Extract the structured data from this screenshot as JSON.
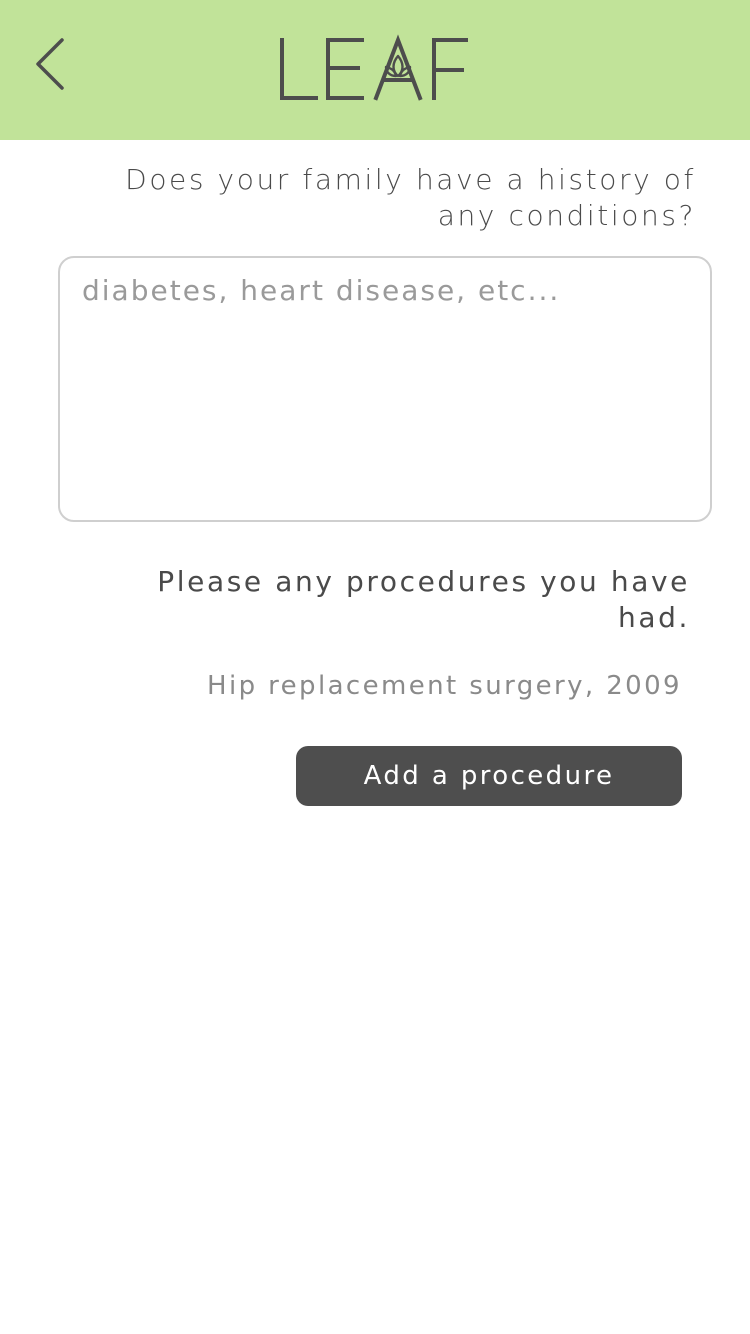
{
  "header": {
    "app_name": "LEAF",
    "background_color": "#c1e399",
    "back_icon": "chevron-left-icon"
  },
  "family_history": {
    "question": "Does your family have a history of any conditions?",
    "input_value": "",
    "input_placeholder": "diabetes, heart disease, etc..."
  },
  "procedures": {
    "question": "Please any procedures you have had.",
    "items": [
      "Hip replacement surgery, 2009"
    ],
    "add_button_label": "Add a procedure",
    "button_color": "#4e4e4e"
  }
}
